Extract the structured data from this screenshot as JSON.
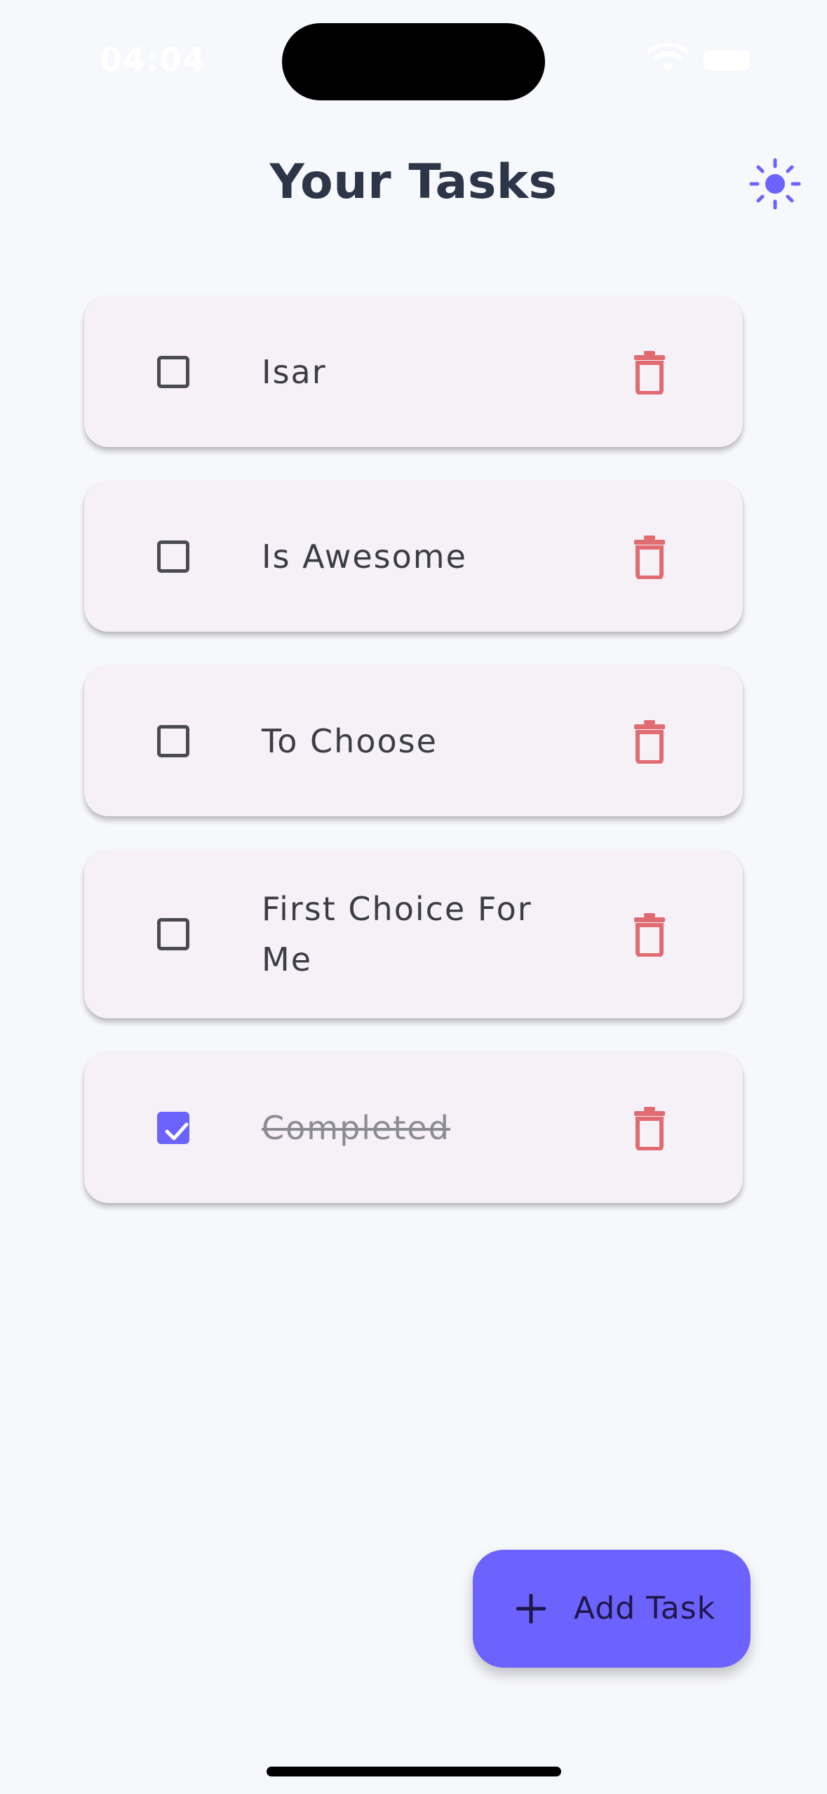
{
  "status_bar": {
    "time": "04:04",
    "icons": [
      "wifi-icon",
      "battery-icon"
    ]
  },
  "header": {
    "title": "Your Tasks",
    "theme_icon": "sun-icon"
  },
  "colors": {
    "accent": "#6c63ff",
    "card_background": "#f6f0f7",
    "page_background": "#f7f8fc",
    "delete_icon": "#e06b70",
    "title_text": "#2d3648"
  },
  "tasks": [
    {
      "label": "Isar",
      "completed": false
    },
    {
      "label": "Is Awesome",
      "completed": false
    },
    {
      "label": "To Choose",
      "completed": false
    },
    {
      "label": "First Choice For Me",
      "completed": false
    },
    {
      "label": "Completed",
      "completed": true
    }
  ],
  "fab": {
    "label": "Add Task",
    "icon": "plus-icon"
  }
}
